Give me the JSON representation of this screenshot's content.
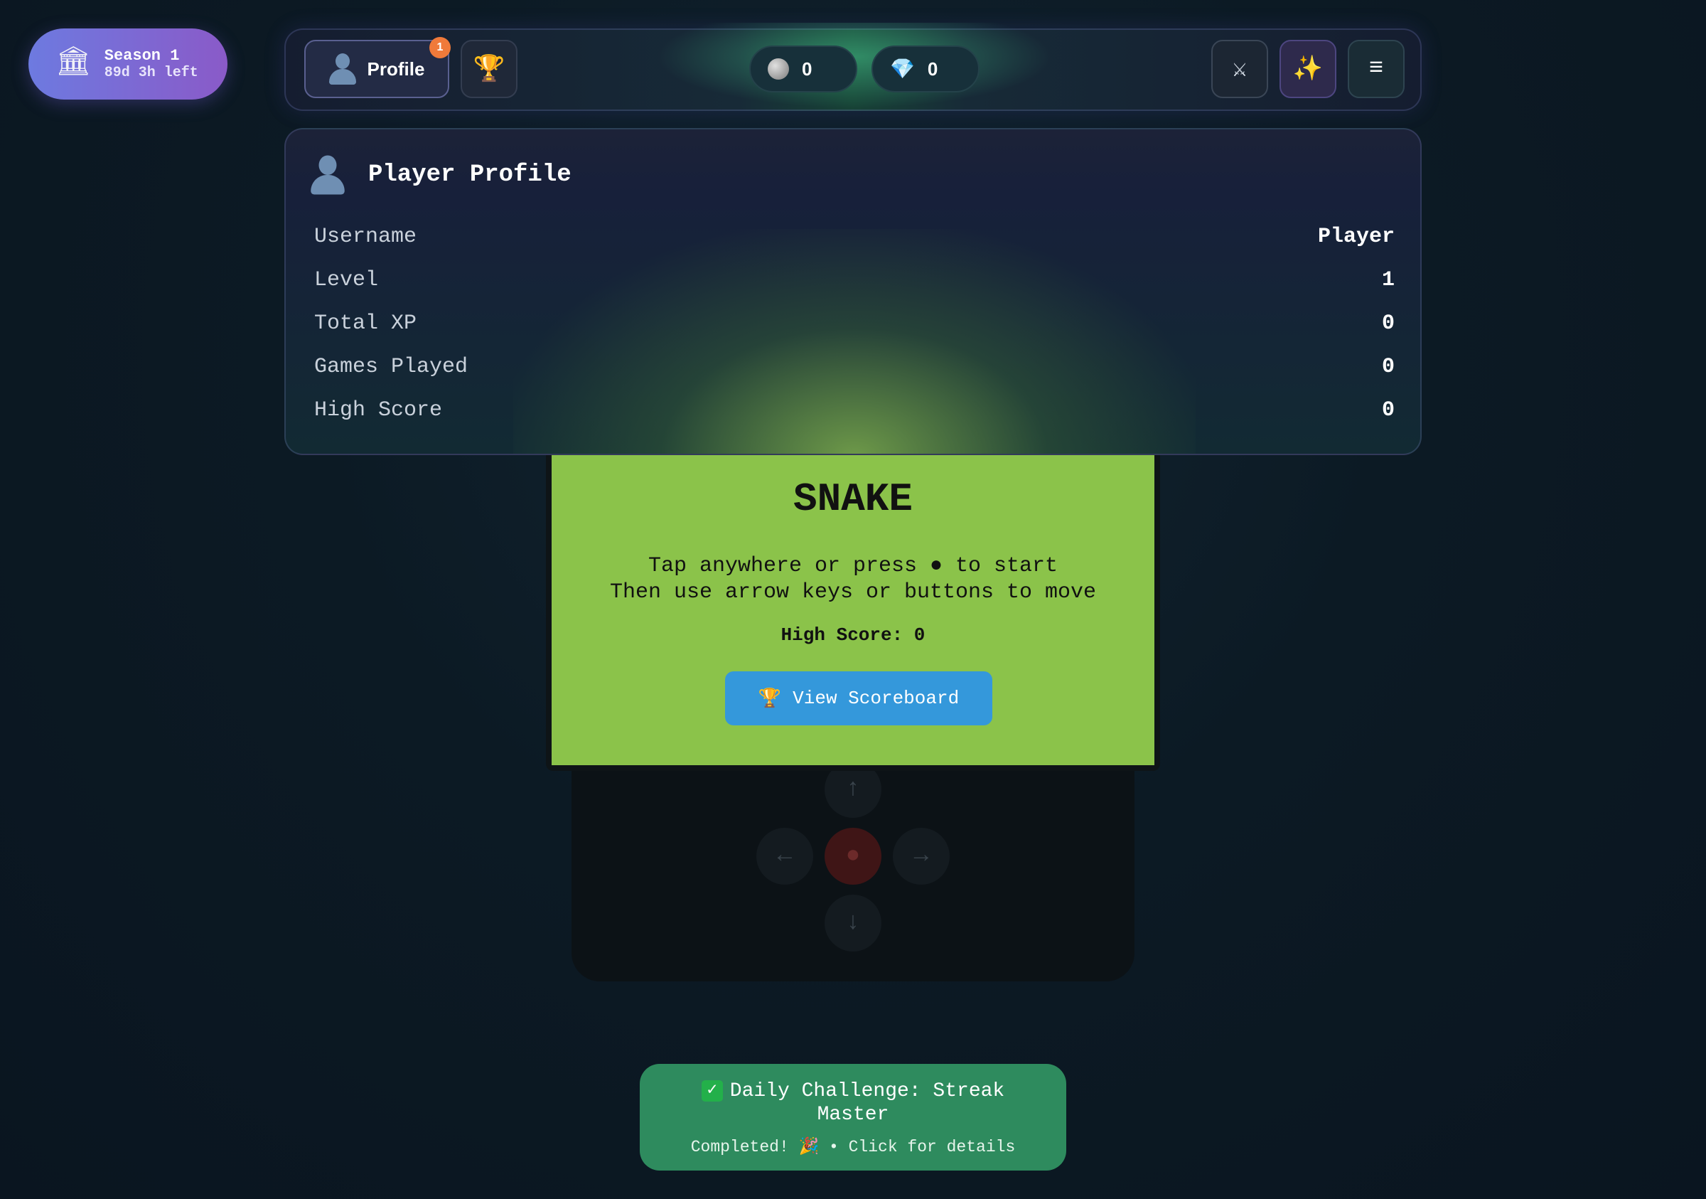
{
  "season": {
    "icon": "bank-icon",
    "title": "Season 1",
    "time_left": "89d 3h left"
  },
  "topbar": {
    "profile_label": "Profile",
    "profile_badge": "1",
    "coins": "0",
    "gems": "0",
    "icons": [
      "trophy-icon",
      "coin-icon",
      "gem-icon",
      "crossed-swords-icon",
      "sparkles-icon",
      "menu-icon"
    ]
  },
  "profile_panel": {
    "title": "Player Profile",
    "rows": [
      {
        "label": "Username",
        "value": "Player"
      },
      {
        "label": "Level",
        "value": "1"
      },
      {
        "label": "Total XP",
        "value": "0"
      },
      {
        "label": "Games Played",
        "value": "0"
      },
      {
        "label": "High Score",
        "value": "0"
      }
    ]
  },
  "game": {
    "title": "SNAKE",
    "instruction_1": "Tap anywhere or press ● to start",
    "instruction_2": "Then use arrow keys or buttons to move",
    "high_score": "High Score: 0",
    "scoreboard_label": "View Scoreboard",
    "controls": {
      "up": "↑",
      "down": "↓",
      "left": "←",
      "right": "→",
      "center": "●"
    }
  },
  "toast": {
    "title": "Daily Challenge: Streak Master",
    "subtitle": "Completed! 🎉 • Click for details"
  },
  "colors": {
    "game_bg": "#8bc34a",
    "scoreboard_button": "#3498db",
    "toast_bg": "#2e8b5e",
    "season_gradient_start": "#6d7ae0",
    "season_gradient_end": "#8a5ac8",
    "badge": "#f07a3a"
  }
}
